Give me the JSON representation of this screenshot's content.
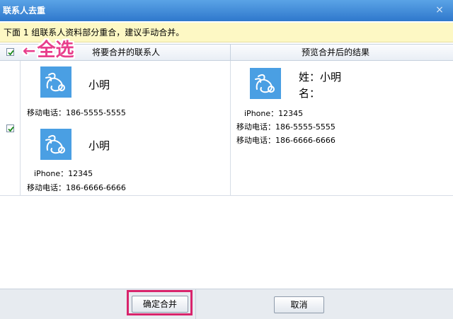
{
  "window": {
    "title": "联系人去重",
    "close_glyph": "×"
  },
  "notice": "下面 1 组联系人资料部分重合，建议手动合并。",
  "header": {
    "left": "将要合并的联系人",
    "right": "预览合并后的结果"
  },
  "annotation": {
    "arrow": "←",
    "text": "全选"
  },
  "contacts": [
    {
      "name": "小明",
      "fields": [
        "移动电话：186-5555-5555"
      ],
      "checked": true
    },
    {
      "name": "小明",
      "fields": [
        "iPhone：12345",
        "移动电话：186-6666-6666"
      ],
      "checked": true
    }
  ],
  "preview": {
    "last_name": "姓：小明",
    "first_name": "名：",
    "fields": [
      "iPhone：12345",
      "移动电话：186-5555-5555",
      "移动电话：186-6666-6666"
    ]
  },
  "buttons": {
    "confirm": "确定合并",
    "cancel": "取消"
  },
  "colors": {
    "title_bar": "#3b86d6",
    "avatar": "#4a9fe3",
    "highlight": "#d8246c",
    "notice_bg": "#fdf8c4"
  },
  "icons": {
    "avatar": "rabbit-icon",
    "check": "checkmark-icon"
  }
}
